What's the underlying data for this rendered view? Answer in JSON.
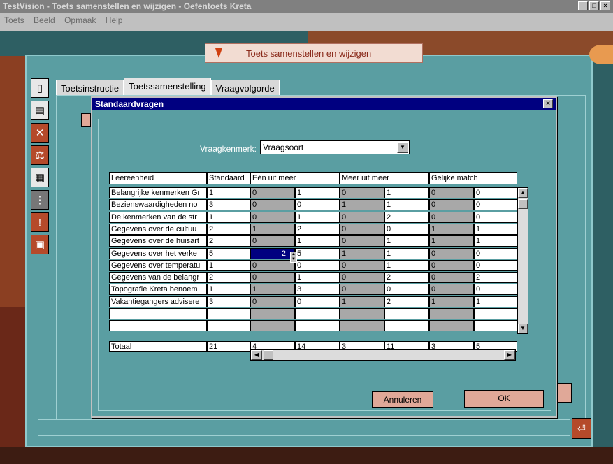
{
  "window": {
    "title": "TestVision - Toets samenstellen en wijzigen - Oefentoets Kreta"
  },
  "menu": [
    "Toets",
    "Beeld",
    "Opmaak",
    "Help"
  ],
  "banner": {
    "text": "Toets samenstellen en wijzigen"
  },
  "tabs": [
    "Toetsinstructie",
    "Toetssamenstelling",
    "Vraagvolgorde"
  ],
  "dialog": {
    "title": "Standaardvragen",
    "vraagkenmerk_label": "Vraagkenmerk:",
    "vraagkenmerk_value": "Vraagsoort",
    "headers": [
      "Leereenheid",
      "Standaard",
      "Eén uit meer",
      "Meer uit meer",
      "Gelijke match"
    ],
    "rows": [
      [
        "Belangrijke kenmerken Gr",
        "1",
        "0",
        "1",
        "0",
        "1",
        "0",
        "0"
      ],
      [
        "Bezienswaardigheden no",
        "3",
        "0",
        "0",
        "1",
        "1",
        "0",
        "0"
      ],
      [
        "De kenmerken van de str",
        "1",
        "0",
        "1",
        "0",
        "2",
        "0",
        "0"
      ],
      [
        "Gegevens over de cultuu",
        "2",
        "1",
        "2",
        "0",
        "0",
        "1",
        "1"
      ],
      [
        "Gegevens over de huisart",
        "2",
        "0",
        "1",
        "0",
        "1",
        "1",
        "1"
      ],
      [
        "Gegevens over het verke",
        "5",
        "2",
        "5",
        "1",
        "1",
        "0",
        "0"
      ],
      [
        "Gegevens over temperatu",
        "1",
        "0",
        "0",
        "0",
        "1",
        "0",
        "0"
      ],
      [
        "Gegevens van de belangr",
        "2",
        "0",
        "1",
        "0",
        "2",
        "0",
        "2"
      ],
      [
        "Topografie Kreta benoem",
        "1",
        "1",
        "3",
        "0",
        "0",
        "0",
        "0"
      ],
      [
        "Vakantiegangers advisere",
        "3",
        "0",
        "0",
        "1",
        "2",
        "1",
        "1"
      ],
      [
        "",
        "",
        "",
        "",
        "",
        "",
        "",
        ""
      ],
      [
        "",
        "",
        "",
        "",
        "",
        "",
        "",
        ""
      ]
    ],
    "totals": [
      "Totaal",
      "21",
      "4",
      "14",
      "3",
      "11",
      "3",
      "5"
    ],
    "cancel_label": "Annuleren",
    "ok_label": "OK"
  }
}
